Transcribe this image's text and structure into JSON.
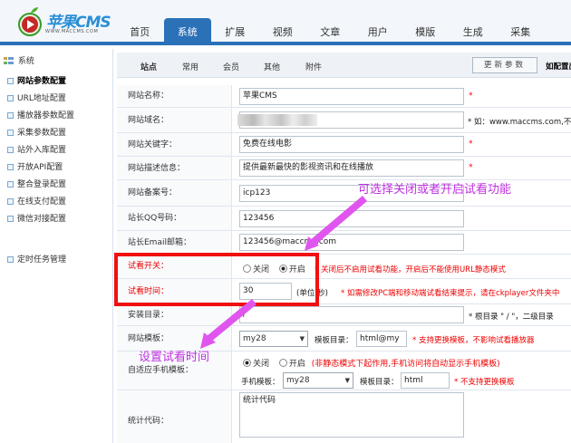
{
  "logo": {
    "brand": "苹果CMS",
    "url": "WWW.MACCMS.COM"
  },
  "nav": [
    "首页",
    "系统",
    "扩展",
    "视频",
    "文章",
    "用户",
    "模版",
    "生成",
    "采集"
  ],
  "nav_active": 1,
  "sidebar": {
    "title": "系统",
    "items": [
      "网站参数配置",
      "URL地址配置",
      "播放器参数配置",
      "采集参数配置",
      "站外入库配置",
      "开放API配置",
      "整合登录配置",
      "在线支付配置",
      "微信对接配置"
    ],
    "extra": "定时任务管理"
  },
  "subtabs": [
    "站点",
    "常用",
    "会员",
    "其他",
    "附件"
  ],
  "update_button": "更新参数",
  "notice": "如配置出错，请手动修改 inc/config/",
  "fields": {
    "site_name": {
      "label": "网站名称：",
      "value": "苹果CMS",
      "star": "*"
    },
    "domain": {
      "label": "网站域名：",
      "hint": "* 如：www.maccms.com,不"
    },
    "keywords": {
      "label": "网站关键字：",
      "value": "免费在线电影",
      "star": "*"
    },
    "description": {
      "label": "网站描述信息：",
      "value": "提供最新最快的影视资讯和在线播放",
      "star": "*"
    },
    "icp": {
      "label": "网站备案号：",
      "value": "icp123"
    },
    "qq": {
      "label": "站长QQ号码：",
      "value": "123456"
    },
    "email": {
      "label": "站长Email邮箱：",
      "value": "123456@maccms.com"
    },
    "trial_switch": {
      "label": "试看开关：",
      "opt_off": "关闭",
      "opt_on": "开启",
      "hint": "* 关闭后不启用试看功能，开启后不能使用URL静态模式"
    },
    "trial_time": {
      "label": "试看时间：",
      "value": "30",
      "unit": "(单位:秒)",
      "hint": "* 如需修改PC端和移动端试看结束提示，请在ckplayer文件夹中"
    },
    "install_dir": {
      "label": "安装目录：",
      "value": "/",
      "hint": "* 根目录 \" / \"，二级目录"
    },
    "template": {
      "label": "网站模板：",
      "select": "my28",
      "dir_label": "模板目录：",
      "dir_value": "html@my",
      "hint": "* 支持更换模板，不影响试看播放器"
    },
    "mobile_tpl": {
      "label": "自适应手机模板：",
      "opt_off": "关闭",
      "opt_on": "开启",
      "note": "(非静态模式下起作用,手机访问将自动显示手机模板)",
      "mobile_label": "手机模板：",
      "select": "my28",
      "dir_label": "模板目录：",
      "dir_value": "html",
      "hint": "* 不支持更换模板"
    },
    "stats": {
      "label": "统计代码：",
      "value": "统计代码"
    }
  },
  "annotations": {
    "top": "可选择关闭或者开启试看功能",
    "bottom": "设置试看时间"
  }
}
